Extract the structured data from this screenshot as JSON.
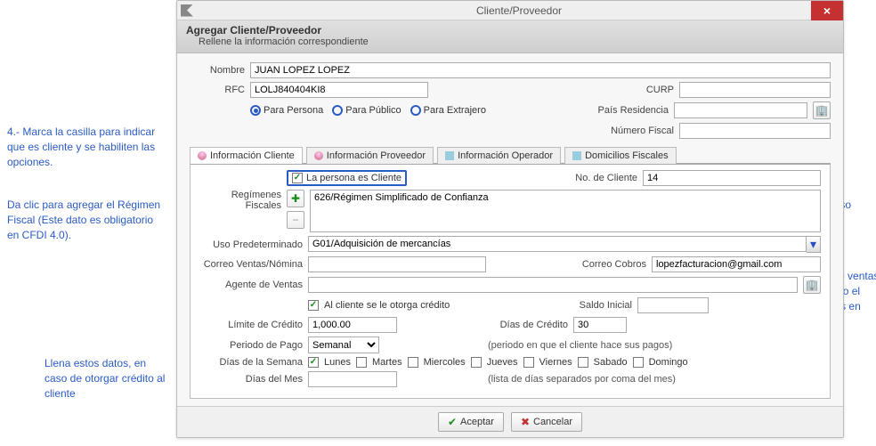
{
  "window": {
    "title": "Cliente/Proveedor",
    "close": "×"
  },
  "banner": {
    "heading": "Agregar Cliente/Proveedor",
    "sub": "Rellene la información correspondiente"
  },
  "top": {
    "nombre_lbl": "Nombre",
    "nombre_val": "JUAN LOPEZ LOPEZ",
    "rfc_lbl": "RFC",
    "rfc_val": "LOLJ840404KI8",
    "curp_lbl": "CURP",
    "curp_val": "",
    "radio_persona": "Para Persona",
    "radio_publico": "Para Público",
    "radio_extranjero": "Para Extrajero",
    "pais_lbl": "País Residencia",
    "pais_val": "",
    "numfiscal_lbl": "Número Fiscal",
    "numfiscal_val": ""
  },
  "tabs": {
    "cliente": "Información Cliente",
    "proveedor": "Información Proveedor",
    "operador": "Información Operador",
    "domicilios": "Domicilios Fiscales"
  },
  "cliente": {
    "es_cliente_lbl": "La persona es Cliente",
    "no_cliente_lbl": "No. de Cliente",
    "no_cliente_val": "14",
    "regimenes_lbl": "Regímenes Fiscales",
    "regimenes_val": "626/Régimen Simplificado de Confianza",
    "uso_lbl": "Uso Predeterminado",
    "uso_val": "G01/Adquisición de mercancías",
    "correo_ventas_lbl": "Correo Ventas/Nómina",
    "correo_ventas_val": "",
    "correo_cobros_lbl": "Correo Cobros",
    "correo_cobros_val": "lopezfacturacion@gmail.com",
    "agente_lbl": "Agente de Ventas",
    "agente_val": "",
    "otorga_credito_lbl": "Al cliente se le otorga crédito",
    "saldo_inicial_lbl": "Saldo Inicial",
    "saldo_inicial_val": "",
    "limite_credito_lbl": "Límite de Crédito",
    "limite_credito_val": "1,000.00",
    "dias_credito_lbl": "Días de Crédito",
    "dias_credito_val": "30",
    "periodo_lbl": "Periodo de Pago",
    "periodo_val": "Semanal",
    "periodo_hint": "(periodo en que el cliente hace sus pagos)",
    "dias_semana_lbl": "Días de la Semana",
    "dias_mes_lbl": "Días del Mes",
    "dias_mes_val": "",
    "dias_mes_hint": "(lista de días separados por coma del mes)",
    "days": {
      "lunes": "Lunes",
      "martes": "Martes",
      "miercoles": "Miercoles",
      "jueves": "Jueves",
      "viernes": "Viernes",
      "sabado": "Sabado",
      "domingo": "Domingo"
    }
  },
  "footer": {
    "aceptar": "Aceptar",
    "cancelar": "Cancelar"
  },
  "annotations": {
    "a1": "4.- Marca la casilla para indicar que es cliente y se habiliten las opciones.",
    "a2": "Da clic para agregar el Régimen Fiscal (Este dato es obligatorio en CFDI 4.0).",
    "a3": "Llena estos datos, en caso de otorgar crédito al cliente",
    "a4": "Pulsa aquí para seleccionar el Uso Predeterminado.",
    "a5": "Asigna correo de ventas o cobro, así como el agente de ventas en caso de tener."
  }
}
